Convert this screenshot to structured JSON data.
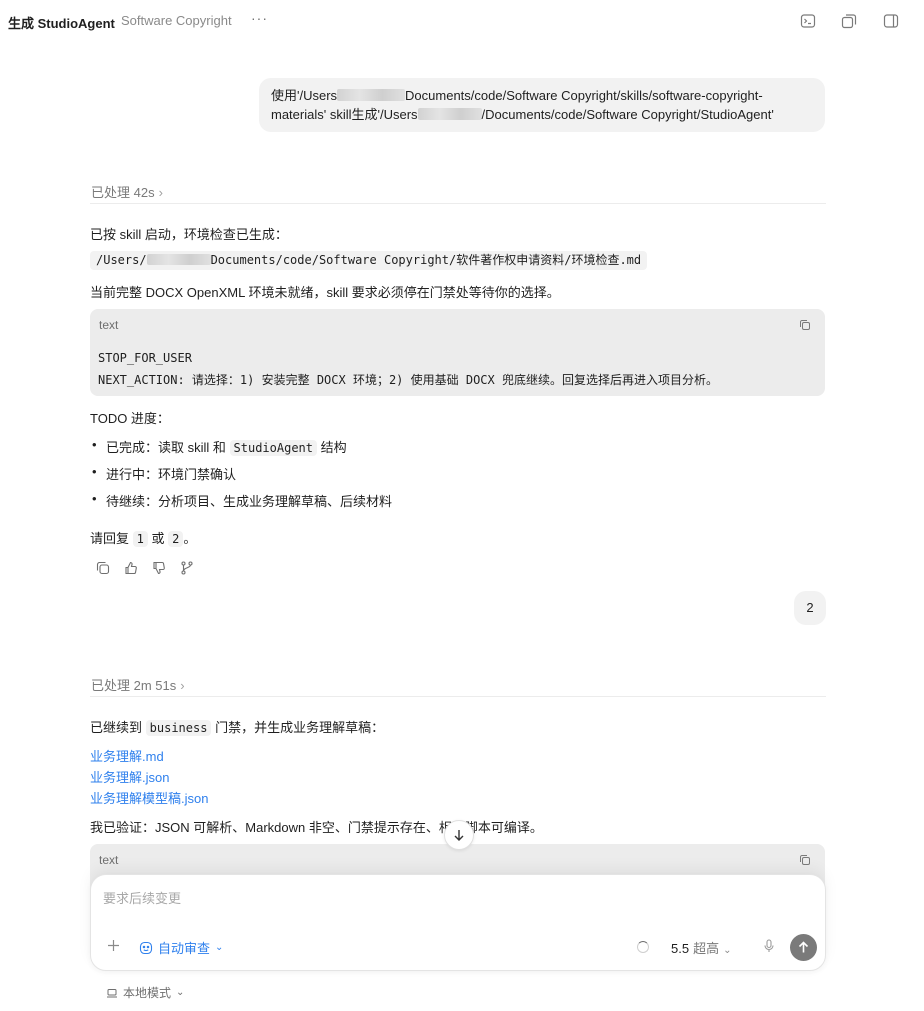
{
  "header": {
    "title": "生成 StudioAgent",
    "project": "Software Copyright",
    "more": "···"
  },
  "thread": [
    {
      "role": "user",
      "line1_prefix": "使用'/Users",
      "line1_suffix": "Documents/code/Software Copyright/skills/software-copyright-",
      "line2_prefix": "materials' skill生成'/Users",
      "line2_suffix": "/Documents/code/Software Copyright/StudioAgent'"
    },
    {
      "role": "assistant",
      "processed": "已处理 42s",
      "intro": "已按 skill 启动，环境检查已生成：",
      "path_prefix": "/Users/",
      "path_suffix": "Documents/code/Software Copyright/软件著作权申请资料/环境检查.md",
      "status_line": "当前完整 DOCX OpenXML 环境未就绪，skill 要求必须停在门禁处等待你的选择。",
      "codeblock": {
        "lang": "text",
        "line1": "STOP_FOR_USER",
        "line2": "NEXT_ACTION: 请选择：1) 安装完整 DOCX 环境；2) 使用基础 DOCX 兜底继续。回复选择后再进入项目分析。"
      },
      "todo_title": "TODO 进度：",
      "todo": {
        "done_prefix": "已完成：读取 skill 和",
        "done_code": "StudioAgent",
        "done_suffix": "结构",
        "in_progress": "进行中：环境门禁确认",
        "pending": "待继续：分析项目、生成业务理解草稿、后续材料"
      },
      "reply_prefix": "请回复",
      "reply_opt1": "1",
      "reply_or": "或",
      "reply_opt2": "2",
      "reply_suffix": "。"
    },
    {
      "role": "user",
      "text": "2"
    },
    {
      "role": "assistant",
      "processed": "已处理 2m 51s",
      "intro_prefix": "已继续到",
      "intro_code": "business",
      "intro_suffix": "门禁，并生成业务理解草稿：",
      "links": [
        "业务理解.md",
        "业务理解.json",
        "业务理解模型稿.json"
      ],
      "verify": "我已验证：JSON 可解析、Markdown 非空、门禁提示存在、相关脚本可编译。",
      "codeblock_lang": "text"
    }
  ],
  "composer": {
    "placeholder": "要求后续变更",
    "auto_review": "自动审查",
    "model": "5.5",
    "level": "超高",
    "mode": "本地模式"
  },
  "colors": {
    "accent": "#2f80ed",
    "bubble": "#f2f2f2",
    "codeblock": "#ececec"
  }
}
